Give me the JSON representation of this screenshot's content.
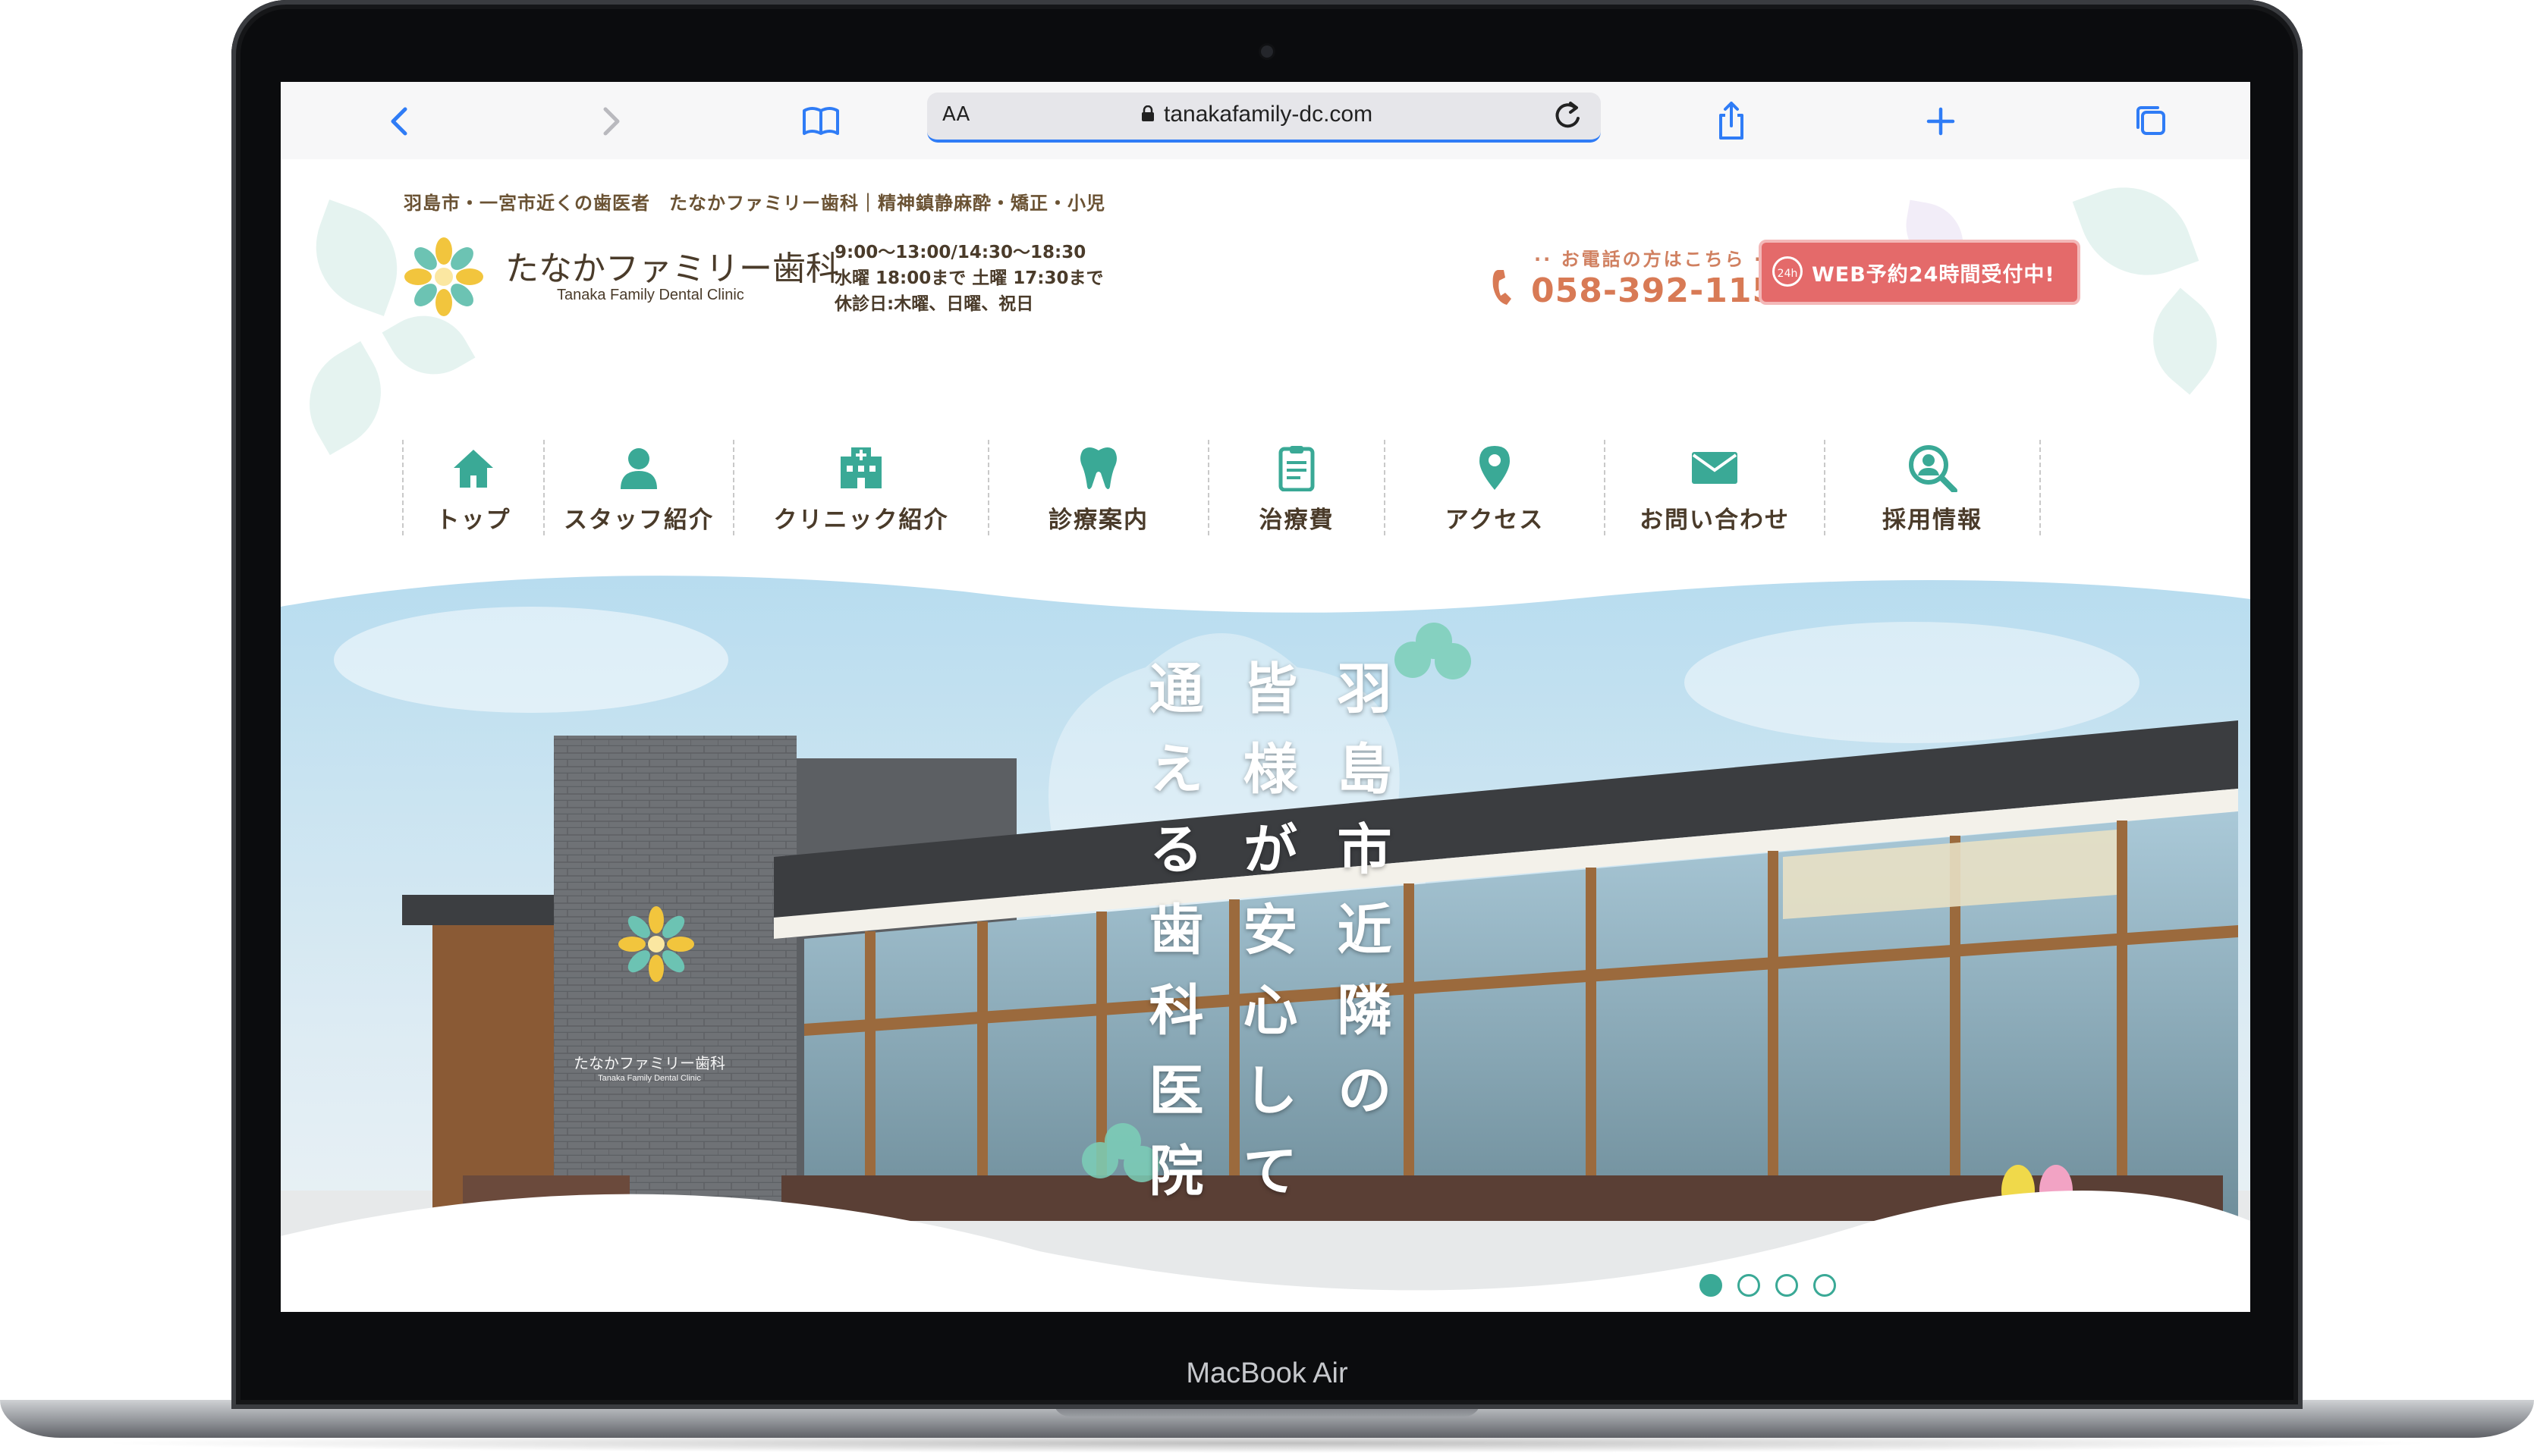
{
  "device": {
    "label": "MacBook Air"
  },
  "browser": {
    "text_size_label": "AA",
    "url": "tanakafamily-dc.com",
    "icons": [
      "back-icon",
      "forward-icon",
      "bookmarks-icon",
      "share-icon",
      "new-tab-icon",
      "tabs-icon",
      "reload-icon",
      "lock-icon"
    ]
  },
  "site": {
    "tagline": "羽島市・一宮市近くの歯医者　たなかファミリー歯科｜精神鎮静麻酔・矯正・小児",
    "logo": {
      "jp": "たなかファミリー歯科",
      "en": "Tanaka Family Dental Clinic"
    },
    "hours": {
      "line1": "9:00～13:00/14:30～18:30",
      "line2": "水曜 18:00まで 土曜 17:30まで",
      "line3": "休診日:木曜、日曜、祝日"
    },
    "phone": {
      "label": "お電話の方はこちら",
      "number": "058-392-1158"
    },
    "web_reserve": {
      "badge": "24h",
      "label": "WEB予約24時間受付中!"
    },
    "nav": [
      {
        "label": "トップ",
        "icon": "home-icon"
      },
      {
        "label": "スタッフ紹介",
        "icon": "person-icon"
      },
      {
        "label": "クリニック紹介",
        "icon": "hospital-icon"
      },
      {
        "label": "診療案内",
        "icon": "tooth-icon"
      },
      {
        "label": "治療費",
        "icon": "clipboard-icon"
      },
      {
        "label": "アクセス",
        "icon": "map-pin-icon"
      },
      {
        "label": "お問い合わせ",
        "icon": "mail-icon"
      },
      {
        "label": "採用情報",
        "icon": "search-person-icon"
      }
    ],
    "hero": {
      "col1": "羽島市近隣の",
      "col2": "皆様が安心して",
      "col3": "通える歯科医院",
      "sign_jp": "たなかファミリー歯科",
      "sign_en": "Tanaka Family Dental Clinic",
      "slides_total": 4,
      "active_slide": 1
    },
    "colors": {
      "accent": "#3aa996",
      "brown": "#4a3b2a",
      "phone": "#d87a55",
      "reserve": "#e46a6a"
    }
  }
}
